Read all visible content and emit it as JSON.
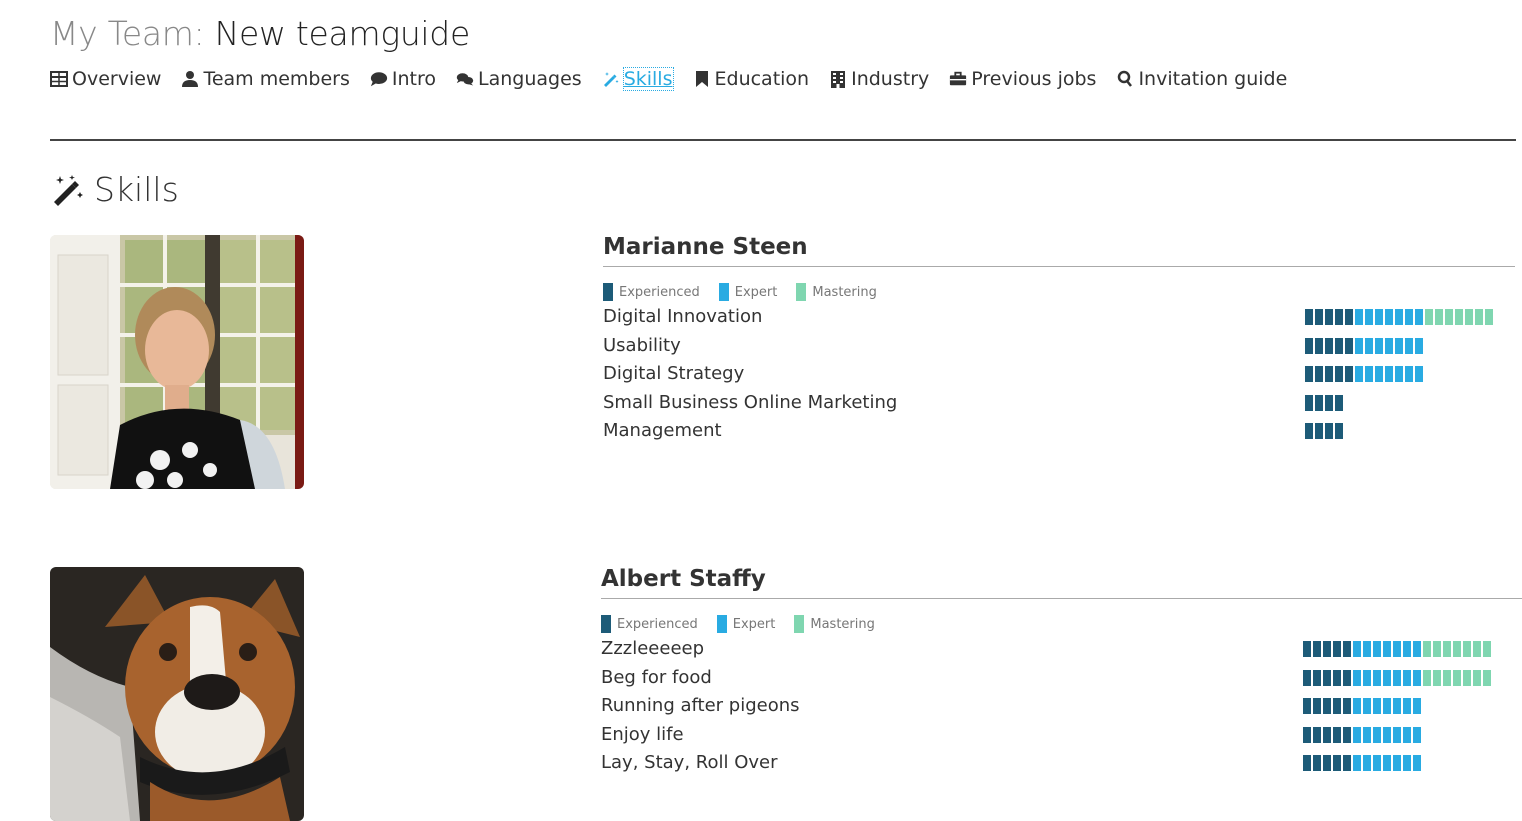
{
  "page": {
    "title_prefix": "My Team:",
    "title_name": "New teamguide",
    "section_title": "Skills"
  },
  "nav": [
    {
      "label": "Overview",
      "icon": "table-icon",
      "active": false
    },
    {
      "label": "Team members",
      "icon": "user-icon",
      "active": false
    },
    {
      "label": "Intro",
      "icon": "comment-icon",
      "active": false
    },
    {
      "label": "Languages",
      "icon": "comments-icon",
      "active": false
    },
    {
      "label": "Skills",
      "icon": "magic-wand-icon",
      "active": true
    },
    {
      "label": "Education",
      "icon": "bookmark-icon",
      "active": false
    },
    {
      "label": "Industry",
      "icon": "building-icon",
      "active": false
    },
    {
      "label": "Previous jobs",
      "icon": "briefcase-icon",
      "active": false
    },
    {
      "label": "Invitation guide",
      "icon": "search-icon",
      "active": false
    }
  ],
  "legend": [
    {
      "label": "Experienced",
      "color": "#1d5b78"
    },
    {
      "label": "Expert",
      "color": "#29abe2"
    },
    {
      "label": "Mastering",
      "color": "#7fd6b0"
    }
  ],
  "members": [
    {
      "name": "Marianne Steen",
      "photo": "woman-portrait",
      "skills": [
        {
          "name": "Digital Innovation",
          "level": 19
        },
        {
          "name": "Usability",
          "level": 12
        },
        {
          "name": "Digital Strategy",
          "level": 12
        },
        {
          "name": "Small Business Online Marketing",
          "level": 4
        },
        {
          "name": "Management",
          "level": 4
        }
      ]
    },
    {
      "name": "Albert Staffy",
      "photo": "dog-portrait",
      "skills": [
        {
          "name": "Zzzleeeeep",
          "level": 19
        },
        {
          "name": "Beg for food",
          "level": 19
        },
        {
          "name": "Running after pigeons",
          "level": 12
        },
        {
          "name": "Enjoy life",
          "level": 12
        },
        {
          "name": "Lay, Stay, Roll Over",
          "level": 12
        }
      ]
    }
  ]
}
